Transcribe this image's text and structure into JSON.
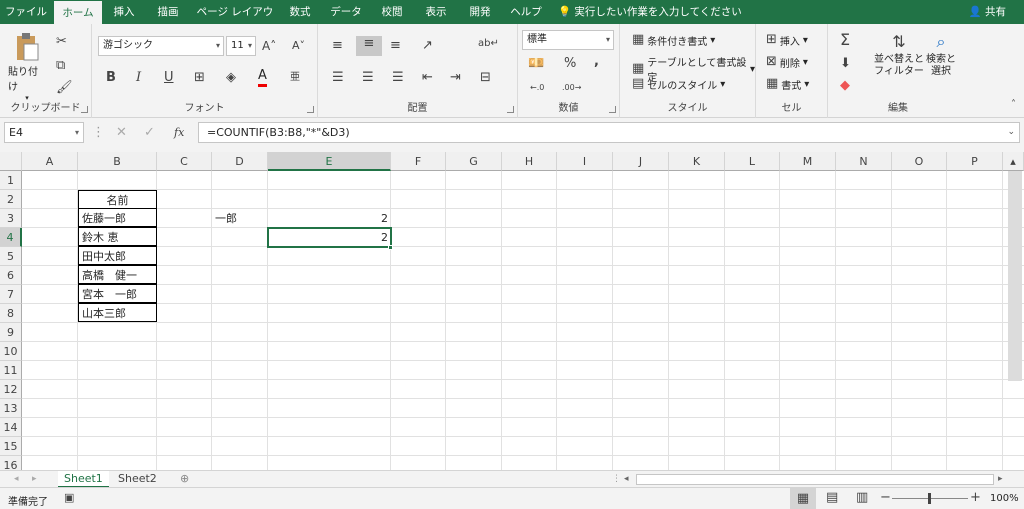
{
  "tabs": [
    "ファイル",
    "ホーム",
    "挿入",
    "描画",
    "ページ レイアウト",
    "数式",
    "データ",
    "校閲",
    "表示",
    "開発",
    "ヘルプ"
  ],
  "tellme": "実行したい作業を入力してください",
  "share": "共有",
  "ribbon": {
    "clipboard": {
      "label": "クリップボード",
      "paste": "貼り付け"
    },
    "font": {
      "label": "フォント",
      "name": "游ゴシック",
      "size": "11",
      "bold": "B",
      "italic": "I",
      "underline": "U"
    },
    "alignment": {
      "label": "配置"
    },
    "number": {
      "label": "数値",
      "format": "標準",
      "percent": "%",
      "comma": ","
    },
    "styles": {
      "label": "スタイル",
      "conditional": "条件付き書式",
      "table": "テーブルとして書式設定",
      "cell_styles": "セルのスタイル"
    },
    "cells": {
      "label": "セル",
      "insert": "挿入",
      "delete": "削除",
      "format": "書式"
    },
    "editing": {
      "label": "編集",
      "sort_line1": "並べ替えと",
      "sort_line2": "フィルター",
      "find_line1": "検索と",
      "find_line2": "選択"
    }
  },
  "formula_bar": {
    "name_box": "E4",
    "fx": "fx",
    "formula": "=COUNTIF(B3:B8,\"*\"&D3)"
  },
  "columns": [
    "A",
    "B",
    "C",
    "D",
    "E",
    "F",
    "G",
    "H",
    "I",
    "J",
    "K",
    "L",
    "M",
    "N",
    "O",
    "P"
  ],
  "rows": [
    "1",
    "2",
    "3",
    "4",
    "5",
    "6",
    "7",
    "8",
    "9",
    "10",
    "11",
    "12",
    "13",
    "14",
    "15",
    "16"
  ],
  "cells": {
    "B2": "名前",
    "B3": "佐藤一郎",
    "B4": "鈴木 恵",
    "B5": "田中太郎",
    "B6": "高橋　健一",
    "B7": "宮本　一郎",
    "B8": "山本三郎",
    "D3": "一郎",
    "E3": "2",
    "E4": "2"
  },
  "sheets": [
    "Sheet1",
    "Sheet2"
  ],
  "status": {
    "ready": "準備完了",
    "zoom": "100%"
  },
  "colors": {
    "accent": "#217346"
  }
}
